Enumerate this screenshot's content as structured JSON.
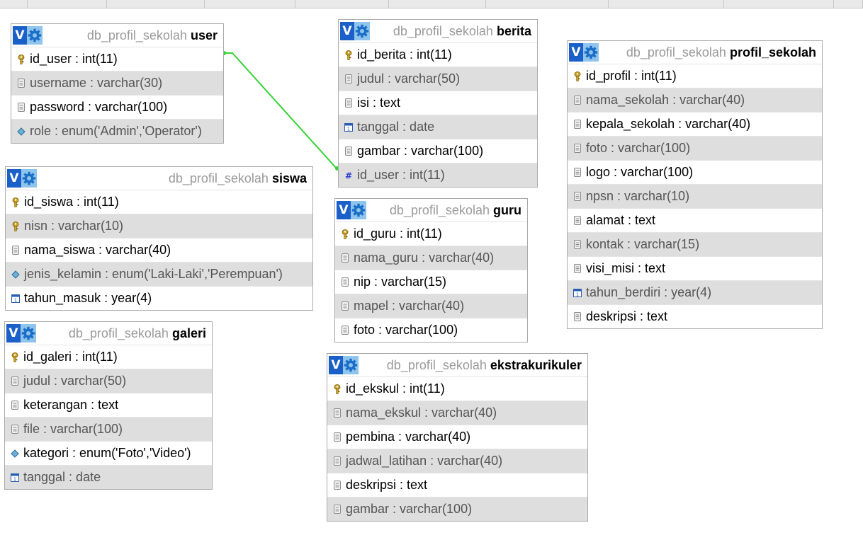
{
  "db_prefix": "db_profil_sekolah",
  "controls": {
    "toggle_label": "V"
  },
  "colors": {
    "relation_line": "#35d335",
    "header_v": "#1b5fc8",
    "header_gear": "#8fc4ec",
    "alt_row": "#dedede"
  },
  "tables": {
    "user": {
      "name": "user",
      "columns": [
        {
          "text": "id_user : int(11)",
          "icon": "primary-key-icon"
        },
        {
          "text": "username : varchar(30)",
          "icon": "column-icon"
        },
        {
          "text": "password : varchar(100)",
          "icon": "column-icon"
        },
        {
          "text": "role : enum('Admin','Operator')",
          "icon": "enum-icon"
        }
      ]
    },
    "berita": {
      "name": "berita",
      "columns": [
        {
          "text": "id_berita : int(11)",
          "icon": "primary-key-icon"
        },
        {
          "text": "judul : varchar(50)",
          "icon": "column-icon"
        },
        {
          "text": "isi : text",
          "icon": "column-icon"
        },
        {
          "text": "tanggal : date",
          "icon": "date-icon"
        },
        {
          "text": "gambar : varchar(100)",
          "icon": "column-icon"
        },
        {
          "text": "id_user : int(11)",
          "icon": "number-icon"
        }
      ]
    },
    "profil_sekolah": {
      "name": "profil_sekolah",
      "columns": [
        {
          "text": "id_profil : int(11)",
          "icon": "primary-key-icon"
        },
        {
          "text": "nama_sekolah : varchar(40)",
          "icon": "column-icon"
        },
        {
          "text": "kepala_sekolah : varchar(40)",
          "icon": "column-icon"
        },
        {
          "text": "foto : varchar(100)",
          "icon": "column-icon"
        },
        {
          "text": "logo : varchar(100)",
          "icon": "column-icon"
        },
        {
          "text": "npsn : varchar(10)",
          "icon": "column-icon"
        },
        {
          "text": "alamat : text",
          "icon": "column-icon"
        },
        {
          "text": "kontak : varchar(15)",
          "icon": "column-icon"
        },
        {
          "text": "visi_misi : text",
          "icon": "column-icon"
        },
        {
          "text": "tahun_berdiri : year(4)",
          "icon": "date-icon"
        },
        {
          "text": "deskripsi : text",
          "icon": "column-icon"
        }
      ]
    },
    "siswa": {
      "name": "siswa",
      "columns": [
        {
          "text": "id_siswa : int(11)",
          "icon": "primary-key-icon"
        },
        {
          "text": "nisn : varchar(10)",
          "icon": "primary-key-icon"
        },
        {
          "text": "nama_siswa : varchar(40)",
          "icon": "column-icon"
        },
        {
          "text": "jenis_kelamin : enum('Laki-Laki','Perempuan')",
          "icon": "enum-icon"
        },
        {
          "text": "tahun_masuk : year(4)",
          "icon": "date-icon"
        }
      ]
    },
    "guru": {
      "name": "guru",
      "columns": [
        {
          "text": "id_guru : int(11)",
          "icon": "primary-key-icon"
        },
        {
          "text": "nama_guru : varchar(40)",
          "icon": "column-icon"
        },
        {
          "text": "nip : varchar(15)",
          "icon": "column-icon"
        },
        {
          "text": "mapel : varchar(40)",
          "icon": "column-icon"
        },
        {
          "text": "foto : varchar(100)",
          "icon": "column-icon"
        }
      ]
    },
    "galeri": {
      "name": "galeri",
      "columns": [
        {
          "text": "id_galeri : int(11)",
          "icon": "primary-key-icon"
        },
        {
          "text": "judul : varchar(50)",
          "icon": "column-icon"
        },
        {
          "text": "keterangan : text",
          "icon": "column-icon"
        },
        {
          "text": "file : varchar(100)",
          "icon": "column-icon"
        },
        {
          "text": "kategori : enum('Foto','Video')",
          "icon": "enum-icon"
        },
        {
          "text": "tanggal : date",
          "icon": "date-icon"
        }
      ]
    },
    "ekstrakurikuler": {
      "name": "ekstrakurikuler",
      "columns": [
        {
          "text": "id_ekskul : int(11)",
          "icon": "primary-key-icon"
        },
        {
          "text": "nama_ekskul : varchar(40)",
          "icon": "column-icon"
        },
        {
          "text": "pembina : varchar(40)",
          "icon": "column-icon"
        },
        {
          "text": "jadwal_latihan : varchar(40)",
          "icon": "column-icon"
        },
        {
          "text": "deskripsi : text",
          "icon": "column-icon"
        },
        {
          "text": "gambar : varchar(100)",
          "icon": "column-icon"
        }
      ]
    }
  }
}
